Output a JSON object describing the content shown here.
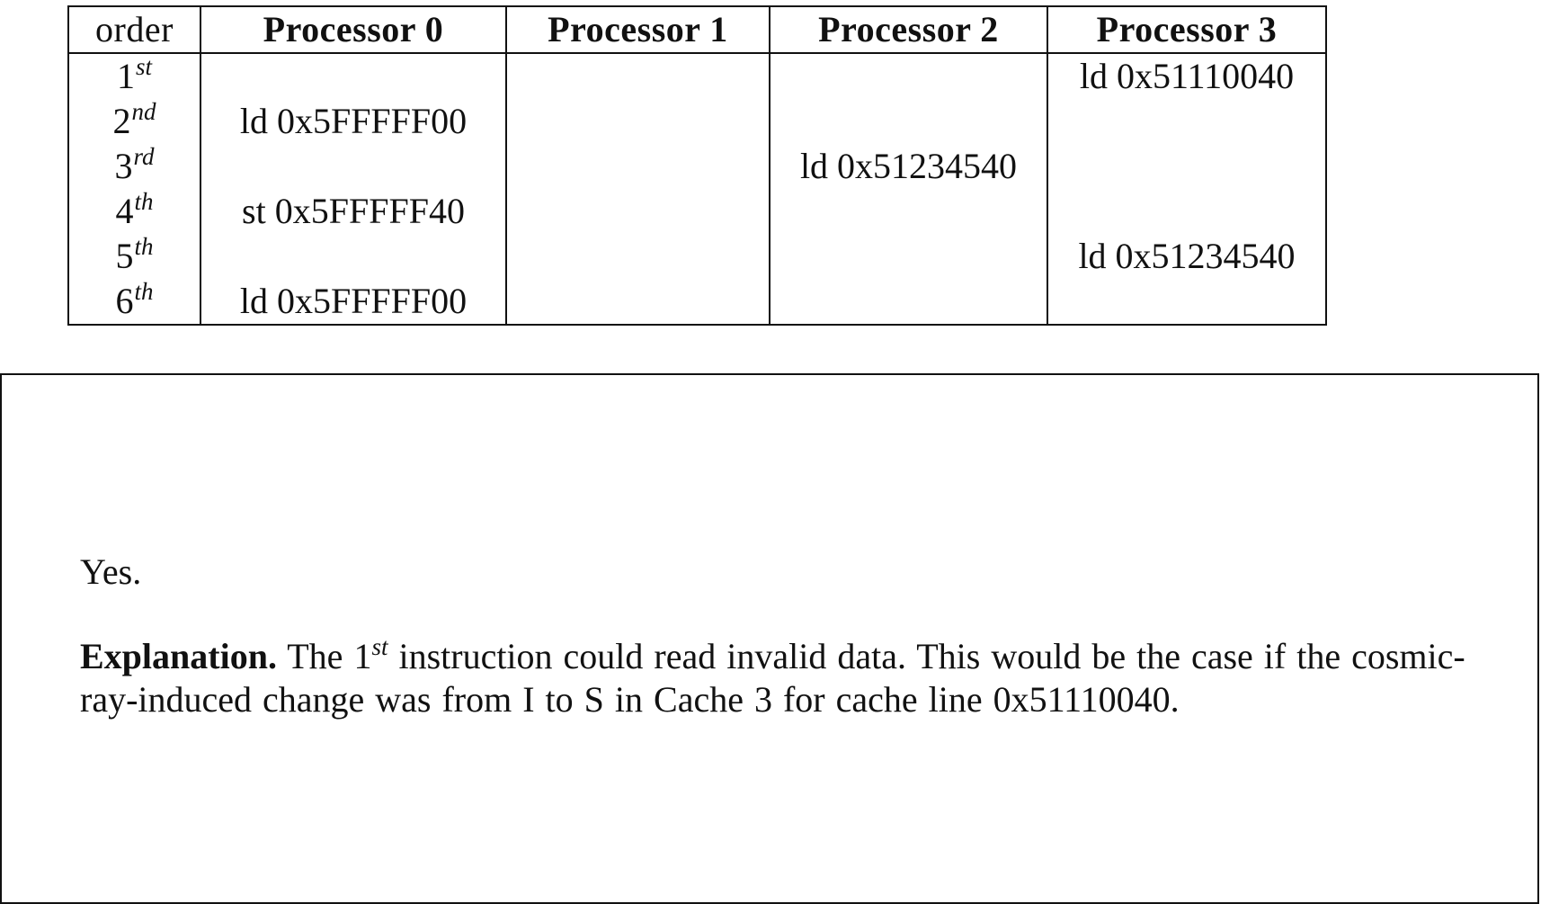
{
  "table": {
    "headers": [
      "order",
      "Processor 0",
      "Processor 1",
      "Processor 2",
      "Processor 3"
    ],
    "rows": [
      {
        "num": "1",
        "suffix": "st",
        "cells": [
          "",
          "",
          "",
          "ld 0x51110040"
        ]
      },
      {
        "num": "2",
        "suffix": "nd",
        "cells": [
          "ld 0x5FFFFF00",
          "",
          "",
          ""
        ]
      },
      {
        "num": "3",
        "suffix": "rd",
        "cells": [
          "",
          "",
          "ld 0x51234540",
          ""
        ]
      },
      {
        "num": "4",
        "suffix": "th",
        "cells": [
          "st 0x5FFFFF40",
          "",
          "",
          ""
        ]
      },
      {
        "num": "5",
        "suffix": "th",
        "cells": [
          "",
          "",
          "",
          "ld 0x51234540"
        ]
      },
      {
        "num": "6",
        "suffix": "th",
        "cells": [
          "ld 0x5FFFFF00",
          "",
          "",
          ""
        ]
      }
    ]
  },
  "answer": {
    "verdict": "Yes.",
    "explanation_label": "Explanation.",
    "explanation_pre": "The 1",
    "explanation_sup": "st",
    "explanation_post": " instruction could read invalid data. This would be the case if the cosmic-ray-induced change was from I to S in Cache 3 for cache line 0x51110040."
  }
}
